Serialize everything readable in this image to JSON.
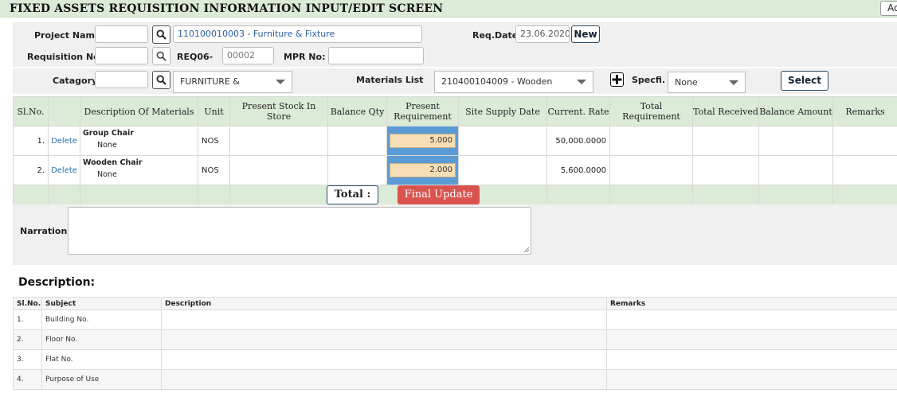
{
  "header": {
    "title": "FIXED ASSETS REQUISITION INFORMATION INPUT/EDIT SCREEN",
    "top_right_button": "Ad"
  },
  "form": {
    "project_label": "Project Name",
    "project_code_value": "",
    "project_name_value": "110100010003 - Furniture & Fixture",
    "req_date_label": "Req.Date",
    "req_date_value": "23.06.2020",
    "new_button": "New",
    "requisition_label": "Requisition No.",
    "requisition_value": "",
    "req_prefix": "REQ06-",
    "req_number_value": "00002",
    "mpr_label": "MPR No:",
    "mpr_value": "",
    "category_label": "Catagory",
    "category_code_value": "",
    "category_select": "FURNITURE &",
    "materials_label": "Materials List",
    "materials_select": "210400104009 - Wooden",
    "spec_label": "Specfi.",
    "spec_select": "None",
    "select_button": "Select"
  },
  "grid": {
    "columns": [
      "Sl.No.",
      "",
      "Description Of Materials",
      "Unit",
      "Present Stock In Store",
      "Balance Qty",
      "Present Requirement",
      "Site Supply Date",
      "Current. Rate",
      "Total Requirement",
      "Total Received",
      "Balance Amount",
      "Remarks"
    ],
    "rows": [
      {
        "sl": "1.",
        "action": "Delete",
        "name": "Group Chair",
        "spec": "None",
        "unit": "NOS",
        "stock": "",
        "balance_qty": "",
        "requirement": "5.000",
        "supply_date": "",
        "rate": "50,000.0000",
        "total_req": "",
        "total_rec": "",
        "balance_amt": "",
        "remarks": ""
      },
      {
        "sl": "2.",
        "action": "Delete",
        "name": "Wooden Chair",
        "spec": "None",
        "unit": "NOS",
        "stock": "",
        "balance_qty": "",
        "requirement": "2.000",
        "supply_date": "",
        "rate": "5,600.0000",
        "total_req": "",
        "total_rec": "",
        "balance_amt": "",
        "remarks": ""
      }
    ],
    "total_label": "Total :",
    "final_update": "Final Update"
  },
  "narration": {
    "label": "Narration:",
    "value": ""
  },
  "description": {
    "heading": "Description:",
    "columns": [
      "Sl.No.",
      "Subject",
      "Description",
      "Remarks"
    ],
    "rows": [
      {
        "sl": "1.",
        "subject": "Building No.",
        "description": "",
        "remarks": ""
      },
      {
        "sl": "2.",
        "subject": "Floor No.",
        "description": "",
        "remarks": ""
      },
      {
        "sl": "3.",
        "subject": "Flat No.",
        "description": "",
        "remarks": ""
      },
      {
        "sl": "4.",
        "subject": "Purpose of Use",
        "description": "",
        "remarks": ""
      }
    ]
  },
  "colors": {
    "header_green": "#dcebd8",
    "requirement_blue": "#5b9bd5",
    "requirement_input": "#f8deb5",
    "final_update_red": "#d9534f",
    "link_blue": "#2a6fb0"
  },
  "icons": [
    "search-icon",
    "plus-icon",
    "chevron-down-icon"
  ]
}
